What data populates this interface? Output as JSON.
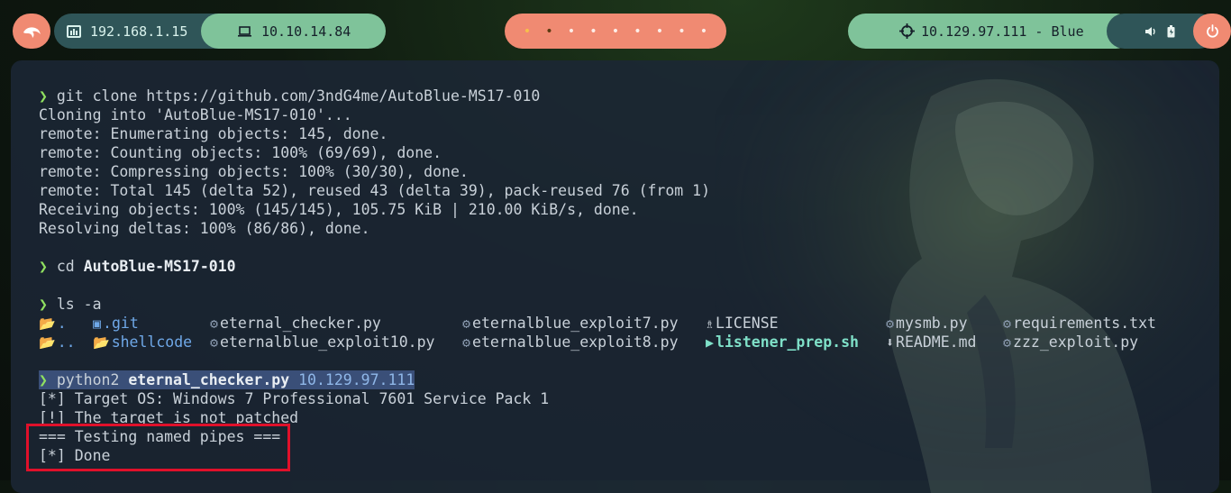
{
  "topbar": {
    "local_ip": "192.168.1.15",
    "vpn_ip": "10.10.14.84",
    "target": "10.129.97.111 - Blue",
    "workspace_dots": [
      "•",
      "•",
      "•",
      "•",
      "•",
      "•",
      "•",
      "•",
      "•"
    ],
    "icons": [
      "kali-dragon-icon",
      "network-icon",
      "laptop-icon",
      "crosshair-icon",
      "volume-icon",
      "battery-icon",
      "power-icon"
    ],
    "colors": {
      "coral": "#f08a72",
      "green": "#7fc39a",
      "teal": "#2f5558"
    }
  },
  "terminal": {
    "prompt_symbol": "❯",
    "cmd1": "git clone https://github.com/3ndG4me/AutoBlue-MS17-010",
    "out1": [
      "Cloning into 'AutoBlue-MS17-010'...",
      "remote: Enumerating objects: 145, done.",
      "remote: Counting objects: 100% (69/69), done.",
      "remote: Compressing objects: 100% (30/30), done.",
      "remote: Total 145 (delta 52), reused 43 (delta 39), pack-reused 76 (from 1)",
      "Receiving objects: 100% (145/145), 105.75 KiB | 210.00 KiB/s, done.",
      "Resolving deltas: 100% (86/86), done."
    ],
    "cmd2_name": "cd",
    "cmd2_arg": "AutoBlue-MS17-010",
    "cmd3": "ls -a",
    "ls": {
      "row1": [
        ".",
        ".git",
        "eternal_checker.py",
        "eternalblue_exploit7.py",
        "LICENSE",
        "mysmb.py",
        "requirements.txt"
      ],
      "row2": [
        "..",
        "shellcode",
        "eternalblue_exploit10.py",
        "eternalblue_exploit8.py",
        "listener_prep.sh",
        "README.md",
        "zzz_exploit.py"
      ]
    },
    "cmd4_name": "python2",
    "cmd4_script": "eternal_checker.py",
    "cmd4_arg": "10.129.97.111",
    "out4": [
      "[*] Target OS: Windows 7 Professional 7601 Service Pack 1",
      "[!] The target is not patched",
      "=== Testing named pipes ===",
      "[*] Done"
    ]
  }
}
